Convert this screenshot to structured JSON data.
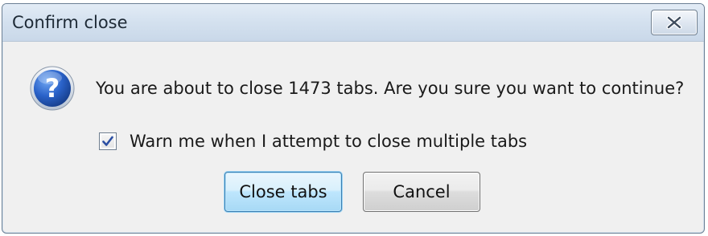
{
  "dialog": {
    "title": "Confirm close",
    "message": "You are about to close 1473 tabs. Are you sure you want to continue?",
    "checkbox": {
      "label": "Warn me when I attempt to close multiple tabs",
      "checked": true
    },
    "buttons": {
      "primary": "Close tabs",
      "secondary": "Cancel"
    },
    "icons": {
      "main": "question-icon",
      "close": "close-icon",
      "check": "checkmark-icon"
    },
    "colors": {
      "titlebar": "#d4e1ef",
      "body": "#f0f0f0",
      "icon_blue": "#2a62c9",
      "primary_border": "#3c7fb1"
    }
  }
}
